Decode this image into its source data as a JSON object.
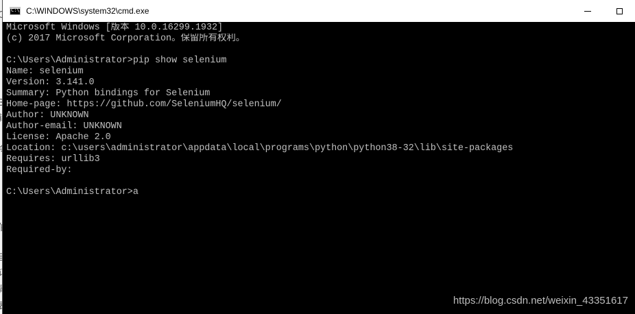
{
  "behind_page": {
    "glyphs": [
      "C",
      "B",
      "辑",
      "令",
      "伯",
      "目",
      "订",
      "肾",
      "表"
    ]
  },
  "window": {
    "title": "C:\\WINDOWS\\system32\\cmd.exe",
    "icon": "console-app-icon",
    "buttons": {
      "minimize_icon": "minimize-icon",
      "maximize_icon": "maximize-icon"
    }
  },
  "console": {
    "background": "#000000",
    "text_color": "#c0c0c0",
    "lines": [
      "Microsoft Windows [版本 10.0.16299.1932]",
      "(c) 2017 Microsoft Corporation。保留所有权利。",
      "",
      "C:\\Users\\Administrator>pip show selenium",
      "Name: selenium",
      "Version: 3.141.0",
      "Summary: Python bindings for Selenium",
      "Home-page: https://github.com/SeleniumHQ/selenium/",
      "Author: UNKNOWN",
      "Author-email: UNKNOWN",
      "License: Apache 2.0",
      "Location: c:\\users\\administrator\\appdata\\local\\programs\\python\\python38-32\\lib\\site-packages",
      "Requires: urllib3",
      "Required-by:",
      "",
      "C:\\Users\\Administrator>a"
    ]
  },
  "watermark": "https://blog.csdn.net/weixin_43351617"
}
